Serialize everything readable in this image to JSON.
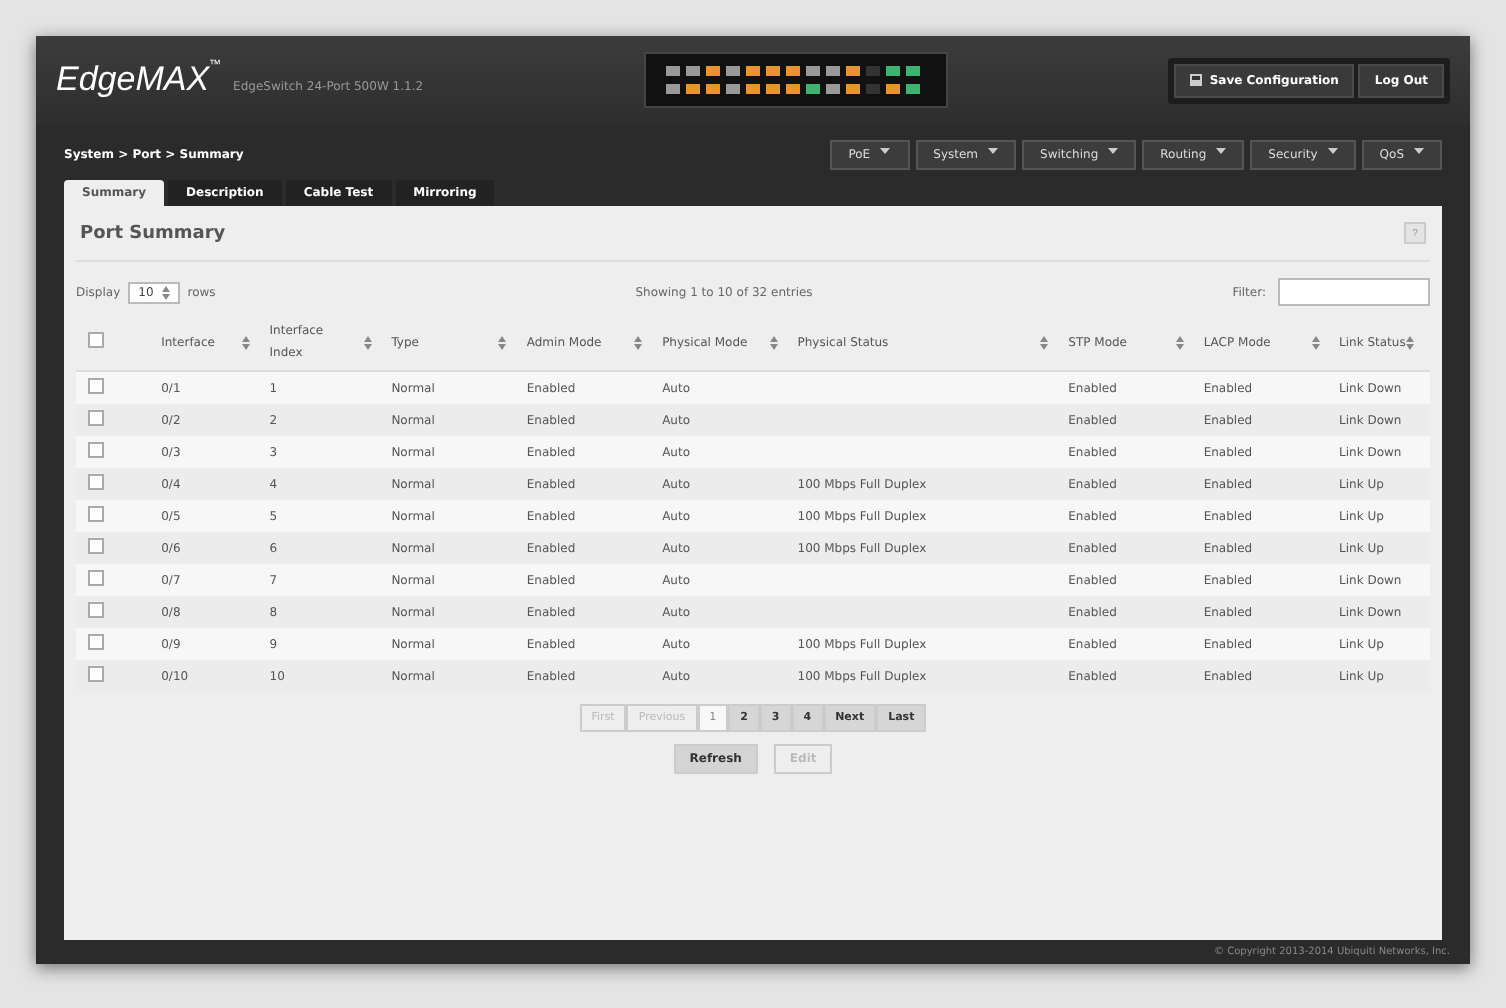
{
  "header": {
    "logo": "EdgeMAX",
    "logo_mark": "™",
    "device": "EdgeSwitch 24-Port 500W 1.1.2",
    "buttons": [
      "Save Configuration",
      "Log Out"
    ]
  },
  "breadcrumb": "System > Port > Summary",
  "menus": [
    "PoE",
    "System",
    "Switching",
    "Routing",
    "Security",
    "QoS"
  ],
  "tabs": [
    {
      "label": "Summary",
      "selected": true
    },
    {
      "label": "Description",
      "selected": false
    },
    {
      "label": "Cable Test",
      "selected": false
    },
    {
      "label": "Mirroring",
      "selected": false
    }
  ],
  "panel": {
    "title": "Port Summary",
    "help": "?",
    "display_label": "Display",
    "display_value": "10",
    "rows_label": "rows",
    "showing": "Showing 1 to 10 of 32 entries",
    "filter_label": "Filter:"
  },
  "table": {
    "select_all_checked": false,
    "columns": [
      "Interface",
      "Interface Index",
      "Type",
      "Admin Mode",
      "Physical Mode",
      "Physical Status",
      "STP Mode",
      "LACP Mode",
      "Link Status"
    ],
    "rows": [
      {
        "checked": false,
        "cells": [
          "0/1",
          "1",
          "Normal",
          "Enabled",
          "Auto",
          "",
          "Enabled",
          "Enabled",
          "Link Down"
        ]
      },
      {
        "checked": false,
        "cells": [
          "0/2",
          "2",
          "Normal",
          "Enabled",
          "Auto",
          "",
          "Enabled",
          "Enabled",
          "Link Down"
        ]
      },
      {
        "checked": false,
        "cells": [
          "0/3",
          "3",
          "Normal",
          "Enabled",
          "Auto",
          "",
          "Enabled",
          "Enabled",
          "Link Down"
        ]
      },
      {
        "checked": false,
        "cells": [
          "0/4",
          "4",
          "Normal",
          "Enabled",
          "Auto",
          "100 Mbps Full Duplex",
          "Enabled",
          "Enabled",
          "Link Up"
        ]
      },
      {
        "checked": false,
        "cells": [
          "0/5",
          "5",
          "Normal",
          "Enabled",
          "Auto",
          "100 Mbps Full Duplex",
          "Enabled",
          "Enabled",
          "Link Up"
        ]
      },
      {
        "checked": false,
        "cells": [
          "0/6",
          "6",
          "Normal",
          "Enabled",
          "Auto",
          "100 Mbps Full Duplex",
          "Enabled",
          "Enabled",
          "Link Up"
        ]
      },
      {
        "checked": false,
        "cells": [
          "0/7",
          "7",
          "Normal",
          "Enabled",
          "Auto",
          "",
          "Enabled",
          "Enabled",
          "Link Down"
        ]
      },
      {
        "checked": false,
        "cells": [
          "0/8",
          "8",
          "Normal",
          "Enabled",
          "Auto",
          "",
          "Enabled",
          "Enabled",
          "Link Down"
        ]
      },
      {
        "checked": false,
        "cells": [
          "0/9",
          "9",
          "Normal",
          "Enabled",
          "Auto",
          "100 Mbps Full Duplex",
          "Enabled",
          "Enabled",
          "Link Up"
        ]
      },
      {
        "checked": false,
        "cells": [
          "0/10",
          "10",
          "Normal",
          "Enabled",
          "Auto",
          "100 Mbps Full Duplex",
          "Enabled",
          "Enabled",
          "Link Up"
        ]
      }
    ]
  },
  "pagination": [
    {
      "label": "First",
      "disabled": true,
      "selected": false
    },
    {
      "label": "Previous",
      "disabled": true,
      "selected": false
    },
    {
      "label": "1",
      "disabled": false,
      "selected": true
    },
    {
      "label": "2",
      "disabled": false,
      "selected": false
    },
    {
      "label": "3",
      "disabled": false,
      "selected": false
    },
    {
      "label": "4",
      "disabled": false,
      "selected": false
    },
    {
      "label": "Next",
      "disabled": false,
      "selected": false
    },
    {
      "label": "Last",
      "disabled": false,
      "selected": false
    }
  ],
  "actions": [
    {
      "label": "Refresh",
      "disabled": false
    },
    {
      "label": "Edit",
      "disabled": true
    }
  ],
  "footer": "© Copyright 2013-2014 Ubiquiti Networks, Inc."
}
